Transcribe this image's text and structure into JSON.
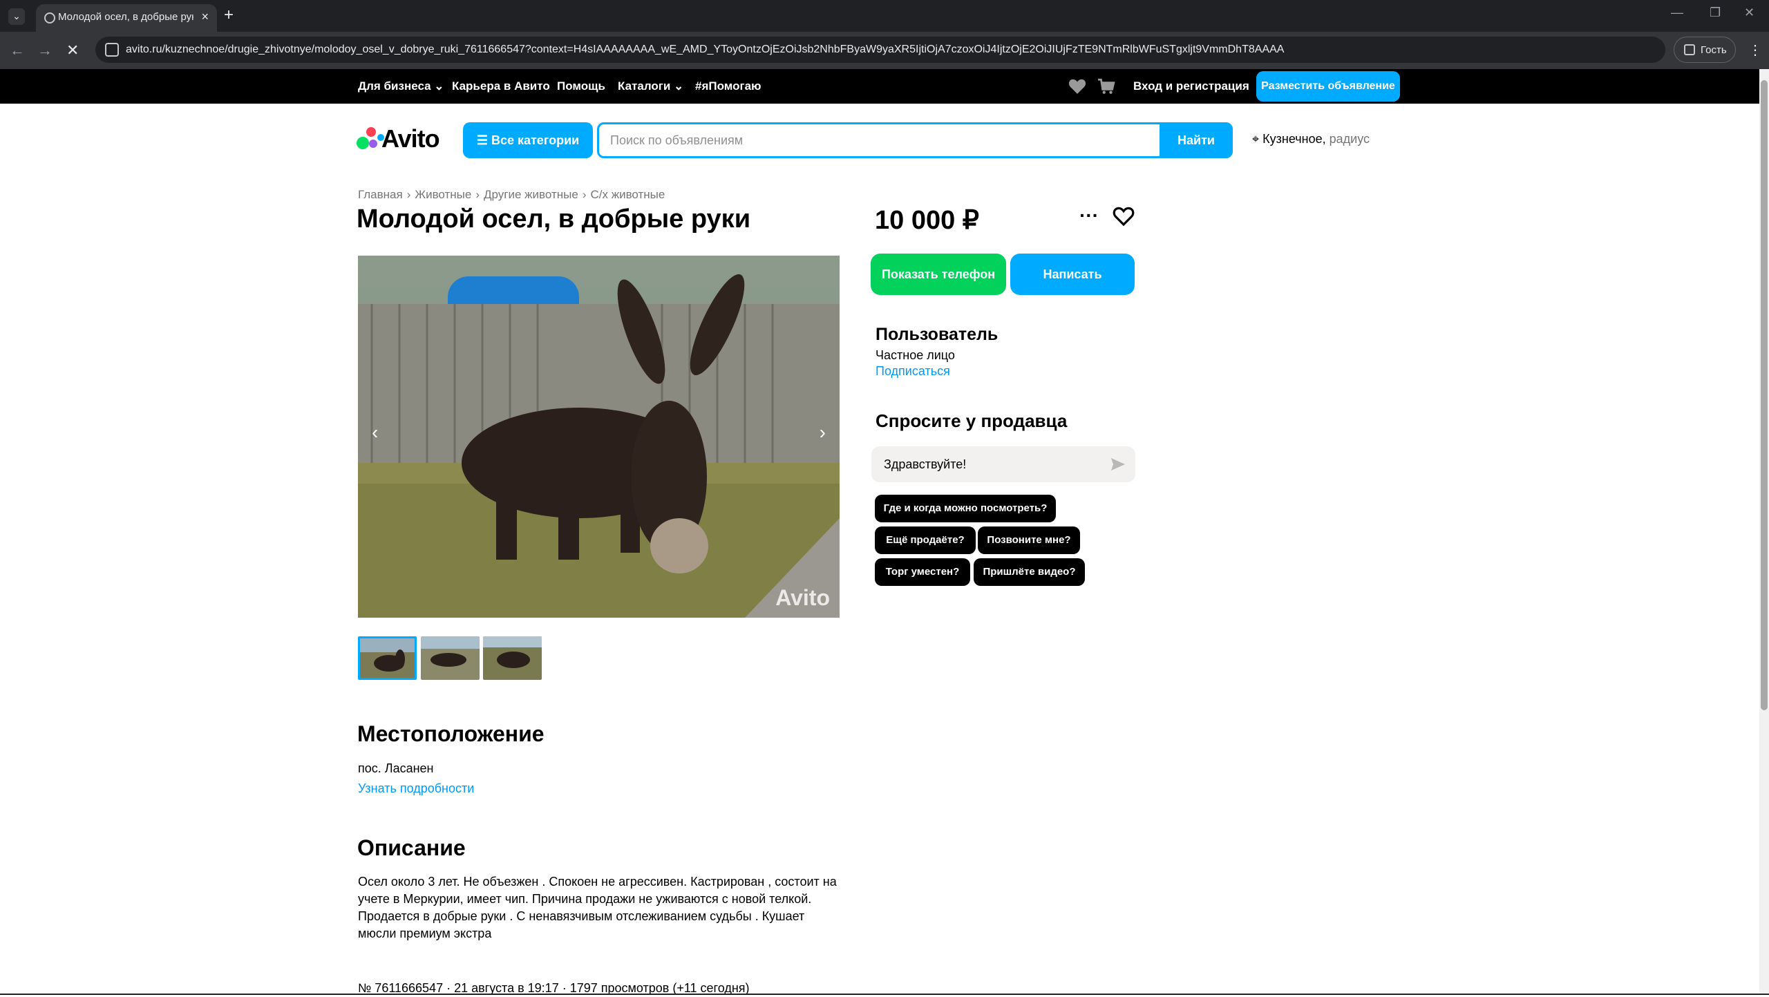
{
  "browser": {
    "tab_title": "Молодой осел, в добрые руки",
    "url": "avito.ru/kuznechnoe/drugie_zhivotnye/molodoy_osel_v_dobrye_ruki_7611666547?context=H4sIAAAAAAAA_wE_AMD_YToyOntzOjEzOiJsb2NhbFByaW9yaXR5IjtiOjA7czoxOiJ4IjtzOjE2OiJIUjFzTE9NTmRlbWFuSTgxljt9VmmDhT8AAAA",
    "profile_label": "Гость"
  },
  "topbar": {
    "items": [
      "Для бизнеса",
      "Карьера в Авито",
      "Помощь",
      "Каталоги",
      "#яПомогаю"
    ],
    "login": "Вход и регистрация",
    "post_ad": "Разместить объявление"
  },
  "header": {
    "logo": "Avito",
    "categories_button": "Все категории",
    "search_placeholder": "Поиск по объявлениям",
    "search_button": "Найти",
    "location_city": "Кузнечное,",
    "location_radius": "радиус"
  },
  "breadcrumbs": [
    "Главная",
    "Животные",
    "Другие животные",
    "С/х животные"
  ],
  "listing": {
    "title": "Молодой осел, в добрые руки",
    "photo_watermark": "Avito",
    "location_heading": "Местоположение",
    "location_text": "пос. Ласанен",
    "location_link": "Узнать подробности",
    "description_heading": "Описание",
    "description": "Осел около 3 лет. Не объезжен . Спокоен не агрессивен. Кастрирован , состоит на учете в Меркурии, имеет чип. Причина продажи не уживаются с новой телкой. Продается в добрые руки . С ненавязчивым отслеживанием судьбы . Кушает мюсли премиум экстра",
    "meta": "№ 7611666547 · 21 августа в 19:17 · 1797 просмотров (+11 сегодня)"
  },
  "sidebar": {
    "price": "10 000 ₽",
    "show_phone": "Показать телефон",
    "write": "Написать",
    "seller_name": "Пользователь",
    "seller_type": "Частное лицо",
    "subscribe": "Подписаться",
    "ask_heading": "Спросите у продавца",
    "ask_input_value": "Здравствуйте!",
    "quick_questions": [
      "Где и когда можно посмотреть?",
      "Ещё продаёте?",
      "Позвоните мне?",
      "Торг уместен?",
      "Пришлёте видео?"
    ]
  },
  "colors": {
    "accent": "#00aaff",
    "phone_button": "#02d15c",
    "link": "#0099f7"
  }
}
